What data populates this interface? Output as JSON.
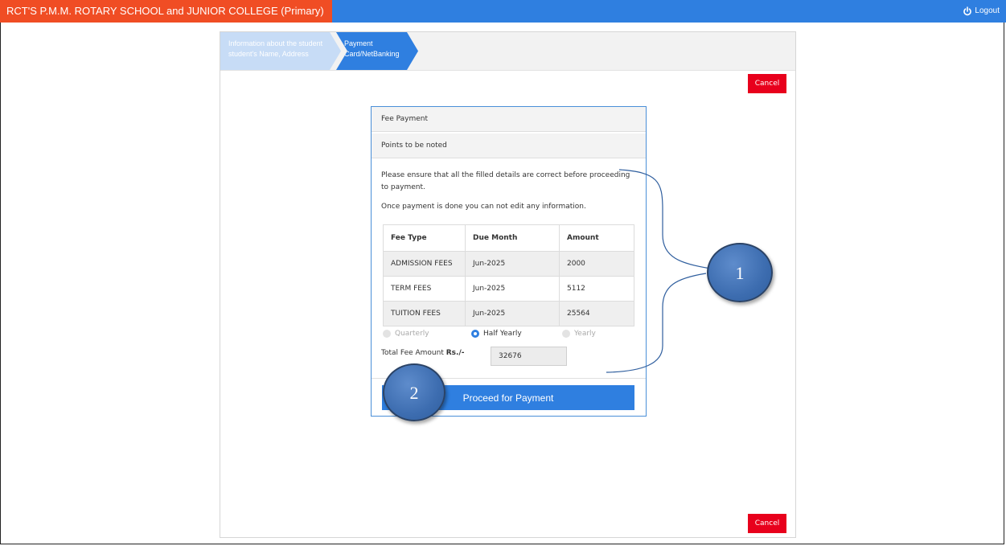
{
  "header": {
    "school_title": "RCT'S P.M.M. ROTARY SCHOOL and JUNIOR COLLEGE (Primary)",
    "logout_label": "Logout"
  },
  "wizard": {
    "steps": [
      {
        "title": "Information about the student",
        "subtitle": "student's Name, Address"
      },
      {
        "title": "Payment",
        "subtitle": "Card/NetBanking"
      }
    ]
  },
  "actions": {
    "cancel_label": "Cancel"
  },
  "fee_card": {
    "title": "Fee Payment",
    "points_heading": "Points to be noted",
    "notes": [
      "Please ensure that all the filled details are correct before proceeding to payment.",
      "Once payment is done you can not edit any information."
    ],
    "table": {
      "headers": [
        "Fee Type",
        "Due Month",
        "Amount"
      ],
      "rows": [
        [
          "ADMISSION FEES",
          "Jun-2025",
          "2000"
        ],
        [
          "TERM FEES",
          "Jun-2025",
          "5112"
        ],
        [
          "TUITION FEES",
          "Jun-2025",
          "25564"
        ]
      ]
    },
    "frequency_options": [
      {
        "label": "Quarterly",
        "selected": false
      },
      {
        "label": "Half Yearly",
        "selected": true
      },
      {
        "label": "Yearly",
        "selected": false
      }
    ],
    "total_label": "Total Fee Amount ",
    "total_currency": "Rs./-",
    "total_value": "32676",
    "proceed_label": "Proceed for Payment"
  },
  "callouts": {
    "one": "1",
    "two": "2"
  },
  "colors": {
    "topbar": "#2f7fe0",
    "school_badge": "#f04d24",
    "cancel": "#e8001c",
    "primary": "#2f7fe0"
  }
}
